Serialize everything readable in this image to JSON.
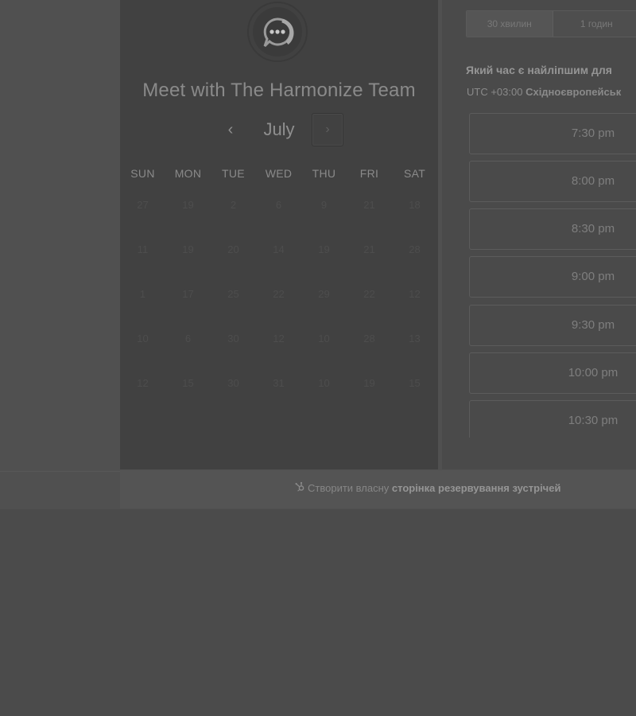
{
  "calendar": {
    "title": "Meet with The Harmonize Team",
    "month": "July",
    "prev_symbol": "‹",
    "next_symbol": "›",
    "weekdays": [
      "SUN",
      "MON",
      "TUE",
      "WED",
      "THU",
      "FRI",
      "SAT"
    ],
    "weeks": [
      [
        "27",
        "19",
        "2",
        "6",
        "9",
        "21",
        "18"
      ],
      [
        "11",
        "19",
        "20",
        "14",
        "19",
        "21",
        "28"
      ],
      [
        "1",
        "17",
        "25",
        "22",
        "29",
        "22",
        "12"
      ],
      [
        "10",
        "6",
        "30",
        "12",
        "10",
        "28",
        "13"
      ],
      [
        "12",
        "15",
        "30",
        "31",
        "10",
        "19",
        "15"
      ]
    ]
  },
  "scheduler": {
    "duration_tabs": [
      "30 хвилин",
      "1 годин"
    ],
    "question": "Який час є найліпшим для",
    "timezone_prefix": "UTC +03:00",
    "timezone_name": "Східноєвропейськ",
    "slots": [
      "7:30 pm",
      "8:00 pm",
      "8:30 pm",
      "9:00 pm",
      "9:30 pm",
      "10:00 pm",
      "10:30 pm"
    ]
  },
  "footer": {
    "prefix": "Створити власну",
    "link": "сторінка резервування зустрічей"
  },
  "colors": {
    "overlay_background": "#4b4b4b",
    "calendar_panel": "#414141",
    "right_panel": "#4a4a4a"
  },
  "icons": {
    "avatar": "chat-bubble-icon",
    "footer": "hubspot-sprocket-icon"
  }
}
